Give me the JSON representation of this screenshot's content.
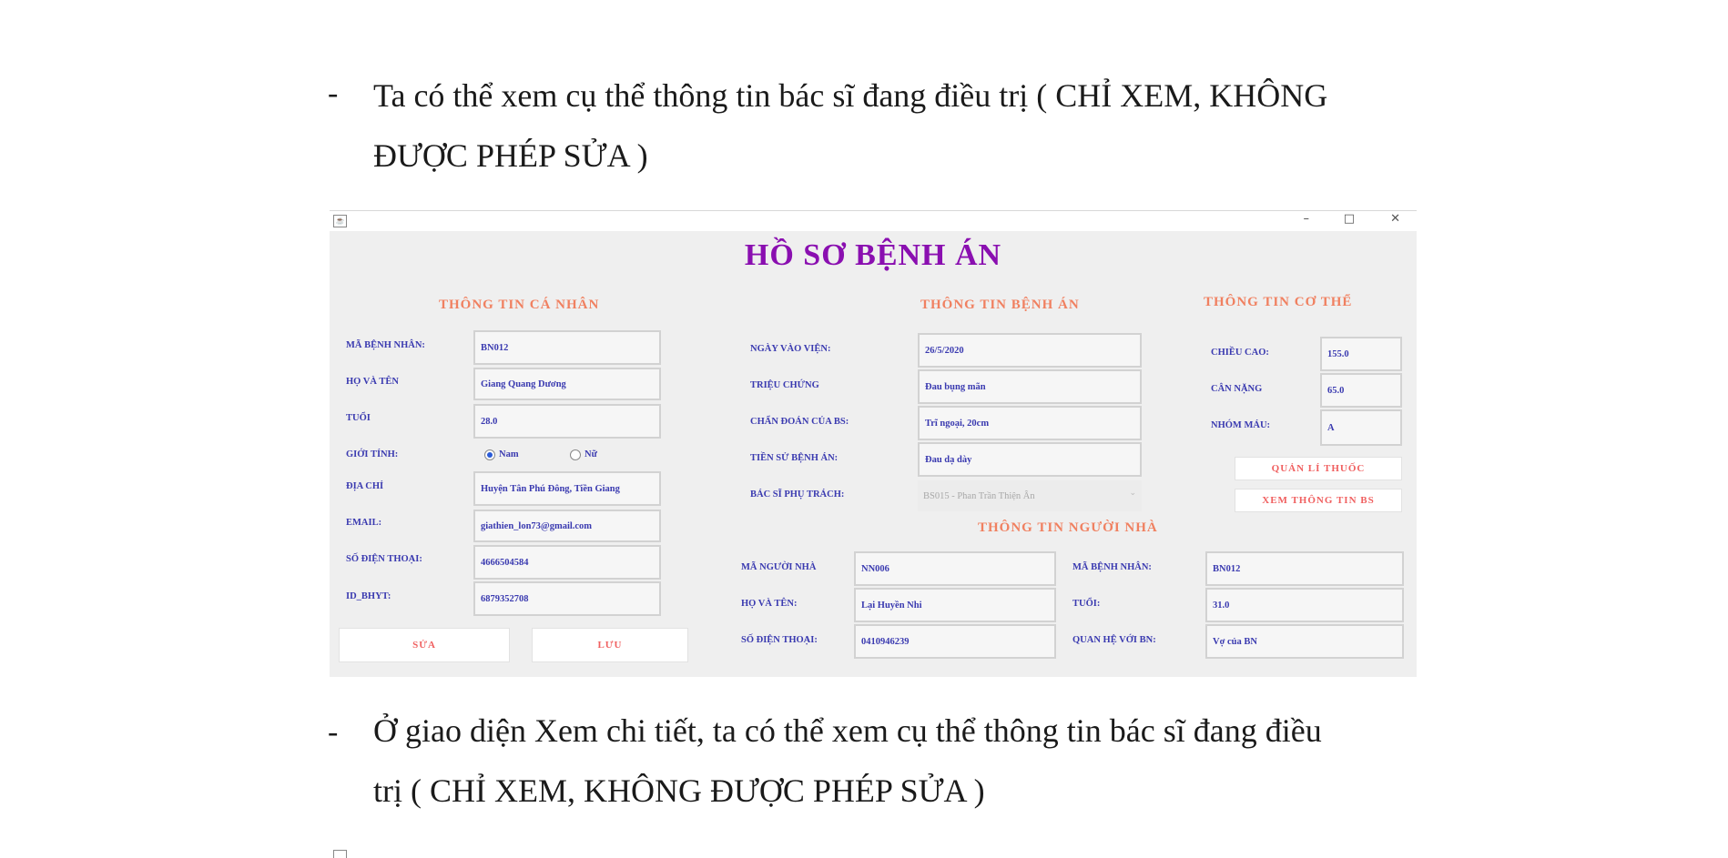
{
  "para1": {
    "bullet": "-",
    "line1": "Ta có thể xem cụ thể thông tin bác sĩ đang điều trị ( CHỈ XEM, KHÔNG",
    "line2": "ĐƯỢC PHÉP SỬA )"
  },
  "window": {
    "minimize": "–",
    "maximize": "□",
    "close": "✕",
    "title": "HỒ SƠ BỆNH ÁN",
    "personal": {
      "heading": "THÔNG TIN CÁ NHÂN",
      "ma_label": "MÃ BỆNH NHÂN:",
      "ma_value": "BN012",
      "ten_label": "HỌ VÀ TÊN",
      "ten_value": "Giang Quang Dương",
      "tuoi_label": "TUỔI",
      "tuoi_value": "28.0",
      "gioitinh_label": "GIỚI TÍNH:",
      "nam_label": "Nam",
      "nu_label": "Nữ",
      "diachi_label": "ĐỊA CHỈ",
      "diachi_value": "Huyện Tân Phú Đông, Tiền Giang",
      "email_label": "EMAIL:",
      "email_value": "giathien_lon73@gmail.com",
      "sdt_label": "SỐ ĐIỆN THOẠI:",
      "sdt_value": "4666504584",
      "bhyt_label": "ID_BHYT:",
      "bhyt_value": "6879352708",
      "sua_button": "SỬA",
      "luu_button": "LƯU"
    },
    "medical": {
      "heading": "THÔNG TIN BỆNH ÁN",
      "ngay_label": "NGÀY VÀO VIỆN:",
      "ngay_value": "26/5/2020",
      "trieuchung_label": "TRIỆU CHỨNG",
      "trieuchung_value": "Đau bụng mãn",
      "chandoan_label": "CHẨN ĐOÁN CỦA BS:",
      "chandoan_value": "Trĩ ngoại, 20cm",
      "tiensu_label": "TIỀN SỬ BỆNH ÁN:",
      "tiensu_value": "Đau dạ dày",
      "bacsi_label": "BÁC SĨ PHỤ TRÁCH:",
      "bacsi_value": "BS015 - Phan Trần Thiện Ân"
    },
    "body": {
      "heading": "THÔNG TIN CƠ THỂ",
      "chieucao_label": "CHIỀU CAO:",
      "chieucao_value": "155.0",
      "cannang_label": "CÂN NẶNG",
      "cannang_value": "65.0",
      "nhommau_label": "NHÓM MÁU:",
      "nhommau_value": "A",
      "quanli_button": "QUẢN LÍ THUỐC",
      "xembs_button": "XEM THÔNG TIN BS"
    },
    "relative": {
      "heading": "THÔNG TIN NGƯỜI NHÀ",
      "ma_label": "MÃ NGƯỜI NHÀ",
      "ma_value": "NN006",
      "ten_label": "HỌ VÀ TÊN:",
      "ten_value": "Lại Huyền Nhi",
      "sdt_label": "SỐ ĐIỆN THOẠI:",
      "sdt_value": "0410946239",
      "mabn_label": "MÃ BỆNH NHÂN:",
      "mabn_value": "BN012",
      "tuoi_label": "TUỔI:",
      "tuoi_value": "31.0",
      "quanhe_label": "QUAN HỆ VỚI BN:",
      "quanhe_value": "Vợ của BN"
    }
  },
  "para2": {
    "bullet": "-",
    "line1": "Ở giao diện Xem chi tiết, ta có thể xem cụ thể thông tin bác sĩ đang điều",
    "line2": "trị ( CHỈ XEM, KHÔNG ĐƯỢC PHÉP SỬA )"
  }
}
